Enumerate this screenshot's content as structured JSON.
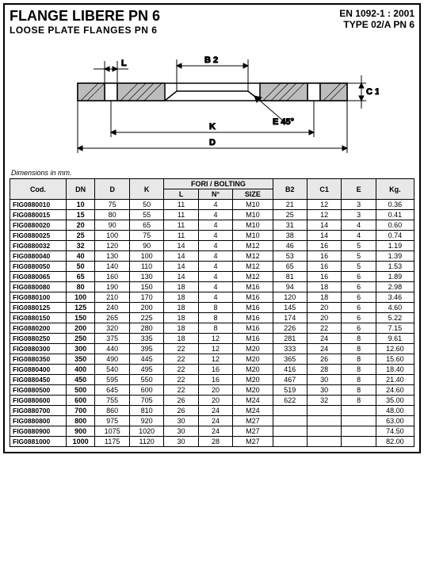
{
  "header": {
    "title": "FLANGE LIBERE PN 6",
    "subtitle": "LOOSE PLATE FLANGES PN 6",
    "std": "EN 1092-1 : 2001",
    "type": "TYPE 02/A PN 6"
  },
  "diagram": {
    "labels": {
      "L": "L",
      "B2": "B 2",
      "C1": "C 1",
      "E45": "E 45°",
      "K": "K",
      "D": "D"
    }
  },
  "dimnote": "Dimensions in mm.",
  "table": {
    "headers": {
      "cod": "Cod.",
      "dn": "DN",
      "d": "D",
      "k": "K",
      "bolting": "FORI / BOLTING",
      "l": "L",
      "n": "N°",
      "size": "SIZE",
      "b2": "B2",
      "c1": "C1",
      "e": "E",
      "kg": "Kg."
    },
    "rows": [
      {
        "cod": "FIG0880010",
        "dn": "10",
        "d": "75",
        "k": "50",
        "l": "11",
        "n": "4",
        "size": "M10",
        "b2": "21",
        "c1": "12",
        "e": "3",
        "kg": "0.36"
      },
      {
        "cod": "FIG0880015",
        "dn": "15",
        "d": "80",
        "k": "55",
        "l": "11",
        "n": "4",
        "size": "M10",
        "b2": "25",
        "c1": "12",
        "e": "3",
        "kg": "0.41"
      },
      {
        "cod": "FIG0880020",
        "dn": "20",
        "d": "90",
        "k": "65",
        "l": "11",
        "n": "4",
        "size": "M10",
        "b2": "31",
        "c1": "14",
        "e": "4",
        "kg": "0.60"
      },
      {
        "cod": "FIG0880025",
        "dn": "25",
        "d": "100",
        "k": "75",
        "l": "11",
        "n": "4",
        "size": "M10",
        "b2": "38",
        "c1": "14",
        "e": "4",
        "kg": "0.74"
      },
      {
        "cod": "FIG0880032",
        "dn": "32",
        "d": "120",
        "k": "90",
        "l": "14",
        "n": "4",
        "size": "M12",
        "b2": "46",
        "c1": "16",
        "e": "5",
        "kg": "1.19"
      },
      {
        "cod": "FIG0880040",
        "dn": "40",
        "d": "130",
        "k": "100",
        "l": "14",
        "n": "4",
        "size": "M12",
        "b2": "53",
        "c1": "16",
        "e": "5",
        "kg": "1.39"
      },
      {
        "cod": "FIG0880050",
        "dn": "50",
        "d": "140",
        "k": "110",
        "l": "14",
        "n": "4",
        "size": "M12",
        "b2": "65",
        "c1": "16",
        "e": "5",
        "kg": "1.53"
      },
      {
        "cod": "FIG0880065",
        "dn": "65",
        "d": "160",
        "k": "130",
        "l": "14",
        "n": "4",
        "size": "M12",
        "b2": "81",
        "c1": "16",
        "e": "6",
        "kg": "1.89"
      },
      {
        "cod": "FIG0880080",
        "dn": "80",
        "d": "190",
        "k": "150",
        "l": "18",
        "n": "4",
        "size": "M16",
        "b2": "94",
        "c1": "18",
        "e": "6",
        "kg": "2.98"
      },
      {
        "cod": "FIG0880100",
        "dn": "100",
        "d": "210",
        "k": "170",
        "l": "18",
        "n": "4",
        "size": "M16",
        "b2": "120",
        "c1": "18",
        "e": "6",
        "kg": "3.46"
      },
      {
        "cod": "FIG0880125",
        "dn": "125",
        "d": "240",
        "k": "200",
        "l": "18",
        "n": "8",
        "size": "M16",
        "b2": "145",
        "c1": "20",
        "e": "6",
        "kg": "4.60"
      },
      {
        "cod": "FIG0880150",
        "dn": "150",
        "d": "265",
        "k": "225",
        "l": "18",
        "n": "8",
        "size": "M16",
        "b2": "174",
        "c1": "20",
        "e": "6",
        "kg": "5.22"
      },
      {
        "cod": "FIG0880200",
        "dn": "200",
        "d": "320",
        "k": "280",
        "l": "18",
        "n": "8",
        "size": "M16",
        "b2": "226",
        "c1": "22",
        "e": "6",
        "kg": "7.15"
      },
      {
        "cod": "FIG0880250",
        "dn": "250",
        "d": "375",
        "k": "335",
        "l": "18",
        "n": "12",
        "size": "M16",
        "b2": "281",
        "c1": "24",
        "e": "8",
        "kg": "9.61"
      },
      {
        "cod": "FIG0880300",
        "dn": "300",
        "d": "440",
        "k": "395",
        "l": "22",
        "n": "12",
        "size": "M20",
        "b2": "333",
        "c1": "24",
        "e": "8",
        "kg": "12.60"
      },
      {
        "cod": "FIG0880350",
        "dn": "350",
        "d": "490",
        "k": "445",
        "l": "22",
        "n": "12",
        "size": "M20",
        "b2": "365",
        "c1": "26",
        "e": "8",
        "kg": "15.60"
      },
      {
        "cod": "FIG0880400",
        "dn": "400",
        "d": "540",
        "k": "495",
        "l": "22",
        "n": "16",
        "size": "M20",
        "b2": "416",
        "c1": "28",
        "e": "8",
        "kg": "18.40"
      },
      {
        "cod": "FIG0880450",
        "dn": "450",
        "d": "595",
        "k": "550",
        "l": "22",
        "n": "16",
        "size": "M20",
        "b2": "467",
        "c1": "30",
        "e": "8",
        "kg": "21.40"
      },
      {
        "cod": "FIG0880500",
        "dn": "500",
        "d": "645",
        "k": "600",
        "l": "22",
        "n": "20",
        "size": "M20",
        "b2": "519",
        "c1": "30",
        "e": "8",
        "kg": "24.60"
      },
      {
        "cod": "FIG0880600",
        "dn": "600",
        "d": "755",
        "k": "705",
        "l": "26",
        "n": "20",
        "size": "M24",
        "b2": "622",
        "c1": "32",
        "e": "8",
        "kg": "35.00"
      },
      {
        "cod": "FIG0880700",
        "dn": "700",
        "d": "860",
        "k": "810",
        "l": "26",
        "n": "24",
        "size": "M24",
        "b2": "",
        "c1": "",
        "e": "",
        "kg": "48.00"
      },
      {
        "cod": "FIG0880800",
        "dn": "800",
        "d": "975",
        "k": "920",
        "l": "30",
        "n": "24",
        "size": "M27",
        "b2": "",
        "c1": "",
        "e": "",
        "kg": "63.00"
      },
      {
        "cod": "FIG0880900",
        "dn": "900",
        "d": "1075",
        "k": "1020",
        "l": "30",
        "n": "24",
        "size": "M27",
        "b2": "",
        "c1": "",
        "e": "",
        "kg": "74.50"
      },
      {
        "cod": "FIG0881000",
        "dn": "1000",
        "d": "1175",
        "k": "1120",
        "l": "30",
        "n": "28",
        "size": "M27",
        "b2": "",
        "c1": "",
        "e": "",
        "kg": "82.00"
      }
    ]
  }
}
